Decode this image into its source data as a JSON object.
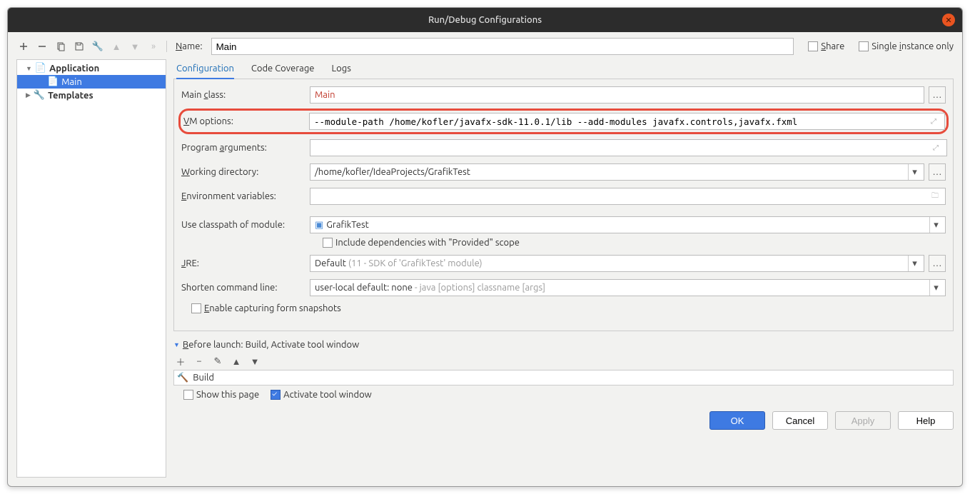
{
  "titlebar": {
    "title": "Run/Debug Configurations"
  },
  "toolbar": {
    "name_label": "Name:"
  },
  "name_value": "Main",
  "share_label": "Share",
  "single_instance_label": "Single instance only",
  "sidebar": {
    "application": "Application",
    "main": "Main",
    "templates": "Templates"
  },
  "tabs": {
    "configuration": "Configuration",
    "code_coverage": "Code Coverage",
    "logs": "Logs"
  },
  "labels": {
    "main_class": "Main class:",
    "vm_options": "VM options:",
    "program_args": "Program arguments:",
    "working_dir": "Working directory:",
    "env_vars": "Environment variables:",
    "classpath": "Use classpath of module:",
    "include_deps": "Include dependencies with \"Provided\" scope",
    "jre": "JRE:",
    "shorten": "Shorten command line:",
    "enable_snapshots": "Enable capturing form snapshots"
  },
  "values": {
    "main_class": "Main",
    "vm_options": "--module-path /home/kofler/javafx-sdk-11.0.1/lib --add-modules javafx.controls,javafx.fxml",
    "program_args": "",
    "working_dir": "/home/kofler/IdeaProjects/GrafikTest",
    "classpath": "GrafikTest",
    "jre_prefix": "Default ",
    "jre_suffix": "(11 - SDK of 'GrafikTest' module)",
    "shorten_prefix": "user-local default: none ",
    "shorten_suffix": "- java [options] classname [args]"
  },
  "before_launch": {
    "header": "Before launch: Build, Activate tool window",
    "item": "Build",
    "show_this_page": "Show this page",
    "activate_tool": "Activate tool window"
  },
  "buttons": {
    "ok": "OK",
    "cancel": "Cancel",
    "apply": "Apply",
    "help": "Help"
  }
}
